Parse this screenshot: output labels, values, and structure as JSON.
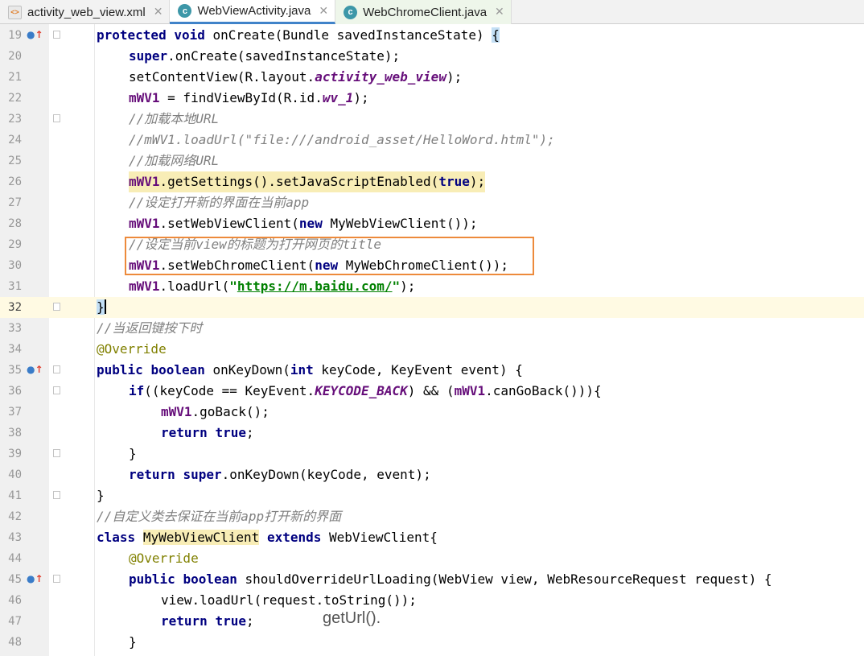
{
  "tabs": [
    {
      "label": "activity_web_view.xml",
      "icon": "xml-file-icon"
    },
    {
      "label": "WebViewActivity.java",
      "icon": "java-class-icon"
    },
    {
      "label": "WebChromeClient.java",
      "icon": "java-class-icon"
    }
  ],
  "close_glyph": "✕",
  "annotation": "getUrl().",
  "lines": {
    "l19": {
      "num": "19",
      "t": [
        "protected",
        " ",
        "void",
        " onCreate(Bundle savedInstanceState) ",
        "{"
      ]
    },
    "l20": {
      "num": "20",
      "t": [
        "super",
        ".onCreate(savedInstanceState);"
      ]
    },
    "l21": {
      "num": "21",
      "t": [
        "setContentView(R.layout.",
        "activity_web_view",
        ");"
      ]
    },
    "l22": {
      "num": "22",
      "t": [
        "mWV1",
        " = findViewById(R.id.",
        "wv_1",
        ");"
      ]
    },
    "l23": {
      "num": "23",
      "t": [
        "//加载本地URL"
      ]
    },
    "l24": {
      "num": "24",
      "t": [
        "//mWV1.loadUrl(\"file:///android_asset/HelloWord.html\");"
      ]
    },
    "l25": {
      "num": "25",
      "t": [
        "//加载网络URL"
      ]
    },
    "l26": {
      "num": "26",
      "t": [
        "mWV1",
        ".getSettings().setJavaScriptEnabled(",
        "true",
        ");"
      ]
    },
    "l27": {
      "num": "27",
      "t": [
        "//设定打开新的界面在当前app"
      ]
    },
    "l28": {
      "num": "28",
      "t": [
        "mWV1",
        ".setWebViewClient(",
        "new",
        " MyWebViewClient());"
      ]
    },
    "l29": {
      "num": "29",
      "t": [
        "//设定当前view的标题为打开网页的title"
      ]
    },
    "l30": {
      "num": "30",
      "t": [
        "mWV1",
        ".setWebChromeClient(",
        "new",
        " MyWebChromeClient());"
      ]
    },
    "l31": {
      "num": "31",
      "t": [
        "mWV1",
        ".loadUrl(",
        "\"",
        "https://m.baidu.com/",
        "\"",
        ");"
      ]
    },
    "l32": {
      "num": "32",
      "t": [
        "}"
      ]
    },
    "l33": {
      "num": "33",
      "t": [
        "//当返回键按下时"
      ]
    },
    "l34": {
      "num": "34",
      "t": [
        "@Override"
      ]
    },
    "l35": {
      "num": "35",
      "t": [
        "public",
        " ",
        "boolean",
        " onKeyDown(",
        "int",
        " keyCode, KeyEvent event) {"
      ]
    },
    "l36": {
      "num": "36",
      "t": [
        "if",
        "((keyCode == KeyEvent.",
        "KEYCODE_BACK",
        ") && (",
        "mWV1",
        ".canGoBack())){"
      ]
    },
    "l37": {
      "num": "37",
      "t": [
        "mWV1",
        ".goBack();"
      ]
    },
    "l38": {
      "num": "38",
      "t": [
        "return",
        " ",
        "true",
        ";"
      ]
    },
    "l39": {
      "num": "39",
      "t": [
        "}"
      ]
    },
    "l40": {
      "num": "40",
      "t": [
        "return",
        " ",
        "super",
        ".onKeyDown(keyCode, event);"
      ]
    },
    "l41": {
      "num": "41",
      "t": [
        "}"
      ]
    },
    "l42": {
      "num": "42",
      "t": [
        "//自定义类去保证在当前app打开新的界面"
      ]
    },
    "l43": {
      "num": "43",
      "t": [
        "class",
        " ",
        "MyWebViewClient",
        " ",
        "extends",
        " WebViewClient{"
      ]
    },
    "l44": {
      "num": "44",
      "t": [
        "@Override"
      ]
    },
    "l45": {
      "num": "45",
      "t": [
        "public",
        " ",
        "boolean",
        " shouldOverrideUrlLoading(WebView view, WebResourceRequest request) {"
      ]
    },
    "l46": {
      "num": "46",
      "t": [
        "view.loadUrl(request.toString());"
      ]
    },
    "l47": {
      "num": "47",
      "t": [
        "return",
        " ",
        "true",
        ";"
      ]
    },
    "l48": {
      "num": "48",
      "t": [
        "}"
      ]
    }
  }
}
